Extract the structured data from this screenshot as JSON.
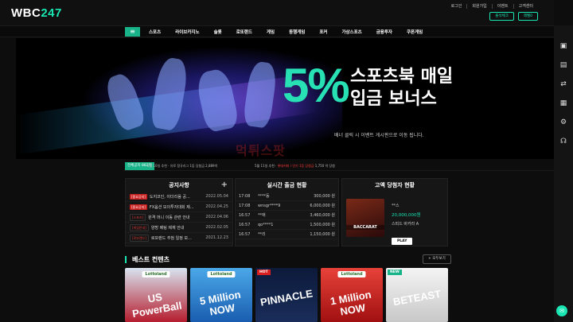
{
  "brand": {
    "logo_prefix": "WBC",
    "logo_num": "247"
  },
  "header": {
    "links": [
      "로그인",
      "회원가입",
      "이벤트",
      "고객센터"
    ],
    "buttons": [
      "출석체크",
      "레벨0"
    ]
  },
  "nav": {
    "menu_icon": "menu-icon",
    "items": [
      "스포츠",
      "라이브카지노",
      "슬롯",
      "로또랜드",
      "게임",
      "동행게임",
      "포커",
      "가상스포츠",
      "금융투자",
      "쿠폰게임"
    ]
  },
  "banner": {
    "percent": "5%",
    "line1": "스포츠북 매일",
    "line2": "입금 보너스",
    "sub": "배너 클릭 시 이벤트 게시판으로 이동 됩니다."
  },
  "ticker": {
    "tag": "전체공지",
    "label": "882억",
    "text1": "5월 10일 추천 · 유로 정규리그 1등 당첨금 2,889억",
    "text2_prefix": "5월 11일 추천 · ",
    "text2_red": "롯데커피 / 인기 1등 당첨금",
    "text2_suffix": " 1,750 억 당첨"
  },
  "notice": {
    "title": "공지사항",
    "items": [
      {
        "tag": "[중요공지]",
        "style": "red",
        "title": "도지코인, 이더리움 공...",
        "date": "2022.05.04"
      },
      {
        "tag": "[중요공지]",
        "style": "red",
        "title": "FX옵션 모의투자대회 제...",
        "date": "2022.04.25"
      },
      {
        "tag": "[스포츠]",
        "style": "grey",
        "title": "원격 머니 이동 관련 안내",
        "date": "2022.04.06"
      },
      {
        "tag": "[게임안내]",
        "style": "grey",
        "title": "양방 베팅 제재 안내",
        "date": "2022.02.05"
      },
      {
        "tag": "[로또랜드]",
        "style": "grey",
        "title": "로또랜드 추첨 일정 보...",
        "date": "2021.12.23"
      }
    ]
  },
  "withdraw": {
    "title": "실시간 출금 현황",
    "rows": [
      {
        "time": "17:08",
        "user": "****동",
        "amount": "300,000 원"
      },
      {
        "time": "17:08",
        "user": "wnsgr****9",
        "amount": "6,000,000 원"
      },
      {
        "time": "16:57",
        "user": "**애",
        "amount": "3,460,000 원"
      },
      {
        "time": "16:57",
        "user": "qo****1",
        "amount": "1,500,000 원"
      },
      {
        "time": "16:57",
        "user": "**리",
        "amount": "1,150,000 원"
      }
    ]
  },
  "jackpot": {
    "title": "고액 당첨자 현황",
    "user": "**스",
    "amount": "20,000,000원",
    "game": "스피드 바카라 A",
    "play": "PLAY",
    "game_label": "BACCARAT"
  },
  "best": {
    "title": "베스트 컨텐츠",
    "more": "+ 모두보기",
    "cards": [
      {
        "top": "Lottoland",
        "big": "US PowerBall",
        "badge": "",
        "bg": "linear-gradient(180deg,#d8e4f0,#b51d2e)"
      },
      {
        "top": "Lottoland",
        "big": "5 Million NOW",
        "badge": "",
        "bg": "linear-gradient(180deg,#4aa8e8,#1a5db0)"
      },
      {
        "top": "",
        "big": "PINNACLE",
        "badge": "HOT",
        "bg": "linear-gradient(180deg,#0c1a3a,#1a2d5a)"
      },
      {
        "top": "Lottoland",
        "big": "1 Million NOW",
        "badge": "",
        "bg": "linear-gradient(180deg,#e8423a,#a01010)"
      },
      {
        "top": "",
        "big": "BETEAST",
        "badge": "NEW",
        "bg": "linear-gradient(180deg,#f4f4f4,#c8c8c8)"
      }
    ]
  },
  "watermark": "먹튀스팟",
  "colors": {
    "accent": "#19e6b3",
    "nav_active": "#19b38a",
    "danger": "#c92020"
  },
  "sidebar_icons": [
    "wallet-icon",
    "receipt-icon",
    "exchange-icon",
    "document-icon",
    "user-settings-icon",
    "headset-icon"
  ]
}
